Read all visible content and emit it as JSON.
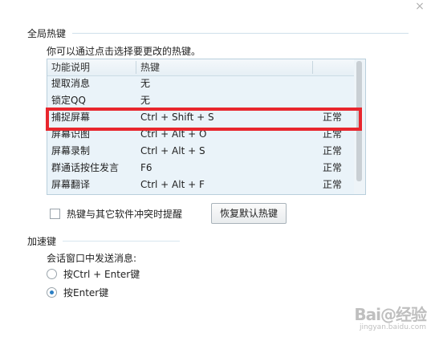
{
  "window": {
    "close_glyph": "×"
  },
  "global_hotkeys": {
    "title": "全局热键",
    "hint": "你可以通过点击选择要更改的热键。",
    "columns": [
      "功能说明",
      "热键",
      ""
    ],
    "rows": [
      {
        "name": "提取消息",
        "hotkey": "无",
        "status": ""
      },
      {
        "name": "锁定QQ",
        "hotkey": "无",
        "status": ""
      },
      {
        "name": "捕捉屏幕",
        "hotkey": "Ctrl + Shift + S",
        "status": "正常"
      },
      {
        "name": "屏幕识图",
        "hotkey": "Ctrl + Alt + O",
        "status": "正常"
      },
      {
        "name": "屏幕录制",
        "hotkey": "Ctrl + Alt + S",
        "status": "正常"
      },
      {
        "name": "群通话按住发言",
        "hotkey": "F6",
        "status": "正常"
      },
      {
        "name": "屏幕翻译",
        "hotkey": "Ctrl + Alt + F",
        "status": "正常"
      }
    ],
    "highlight_color": "#e8262d",
    "conflict_checkbox_label": "热键与其它软件冲突时提醒",
    "restore_button_label": "恢复默认热键"
  },
  "accelerator": {
    "title": "加速键",
    "send_label": "会话窗口中发送消息:",
    "options": [
      "按Ctrl + Enter键",
      "按Enter键"
    ],
    "selected": "按Enter键"
  },
  "watermark": {
    "main": "Bai@经验",
    "sub": "jingyan.baidu.com"
  }
}
